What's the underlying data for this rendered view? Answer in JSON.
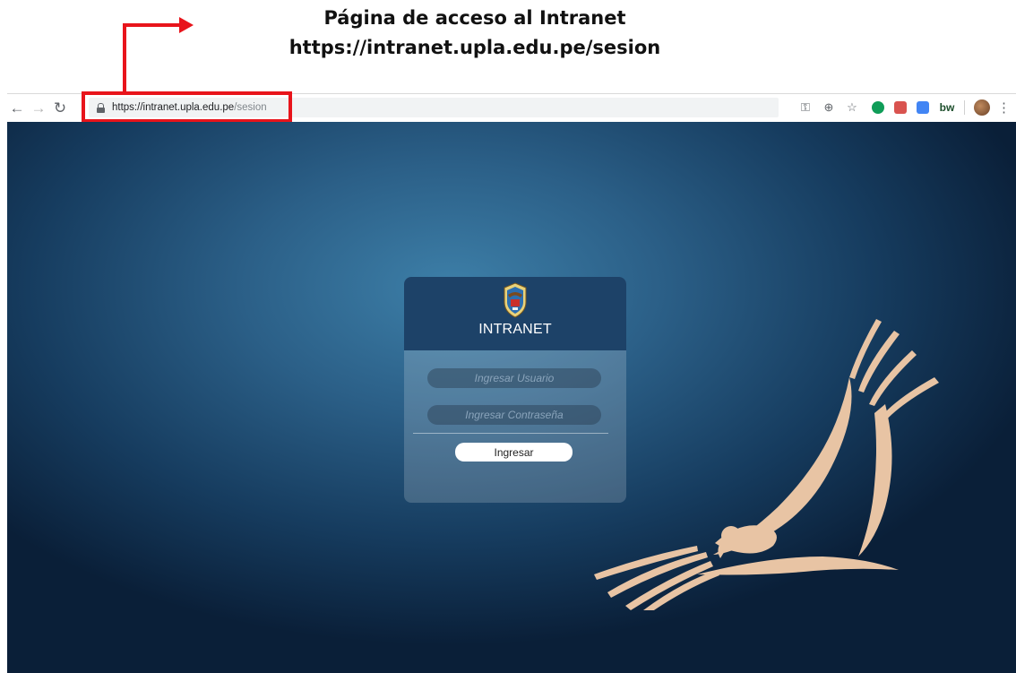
{
  "annotation": {
    "title": "Página de acceso al Intranet",
    "url": "https://intranet.upla.edu.pe/sesion",
    "accent_color": "#e8141b"
  },
  "browser": {
    "url_host": "https://intranet.upla.edu.pe",
    "url_path": "/sesion",
    "icons": [
      "back-arrow-icon",
      "forward-arrow-icon",
      "reload-icon",
      "lock-icon",
      "key-icon",
      "zoom-icon",
      "star-icon",
      "hangouts-extension-icon",
      "pdf-extension-icon",
      "translate-extension-icon",
      "bw-extension-icon",
      "profile-avatar",
      "menu-icon"
    ],
    "bw_label": "bw"
  },
  "login": {
    "title": "INTRANET",
    "user_placeholder": "Ingresar Usuario",
    "password_placeholder": "Ingresar Contraseña",
    "submit_label": "Ingresar",
    "header_color": "#1d4268"
  }
}
